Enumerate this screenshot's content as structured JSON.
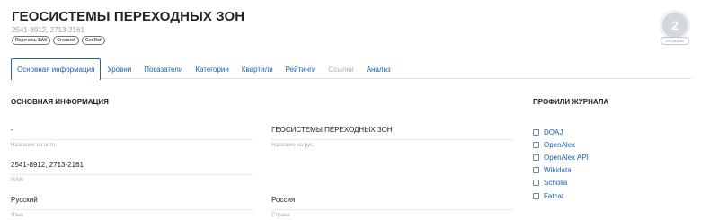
{
  "journal": {
    "title": "ГЕОСИСТЕМЫ ПЕРЕХОДНЫХ ЗОН",
    "issn": "2541-8912, 2713-2161",
    "badges": [
      "Перечень ВАК",
      "Crossref",
      "GeoRef"
    ]
  },
  "level": {
    "value": "2",
    "label": "УРОВЕНЬ"
  },
  "tabs": [
    {
      "label": "Основная информация",
      "state": "active"
    },
    {
      "label": "Уровни",
      "state": "normal"
    },
    {
      "label": "Показатели",
      "state": "normal"
    },
    {
      "label": "Категории",
      "state": "normal"
    },
    {
      "label": "Квартили",
      "state": "normal"
    },
    {
      "label": "Рейтинги",
      "state": "normal"
    },
    {
      "label": "Ссылки",
      "state": "disabled"
    },
    {
      "label": "Анализ",
      "state": "normal"
    }
  ],
  "main": {
    "section_title": "ОСНОВНАЯ ИНФОРМАЦИЯ",
    "fields": {
      "name_en": {
        "value": "-",
        "label": "Название на англ."
      },
      "name_ru": {
        "value": "ГЕОСИСТЕМЫ ПЕРЕХОДНЫХ ЗОН",
        "label": "Название на рус."
      },
      "issn": {
        "value": "2541-8912, 2713-2161",
        "label": "ISSN"
      },
      "language": {
        "value": "Русский",
        "label": "Язык"
      },
      "country": {
        "value": "Россия",
        "label": "Страна"
      }
    }
  },
  "profiles": {
    "title": "ПРОФИЛИ ЖУРНАЛА",
    "items": [
      "DOAJ",
      "OpenAlex",
      "OpenAlex API",
      "Wikidata",
      "Scholia",
      "Fatcat"
    ]
  },
  "colors": {
    "link": "#1a5fb4",
    "active_tab_border": "#2e63a8",
    "level_circle": "#d3d8de"
  }
}
